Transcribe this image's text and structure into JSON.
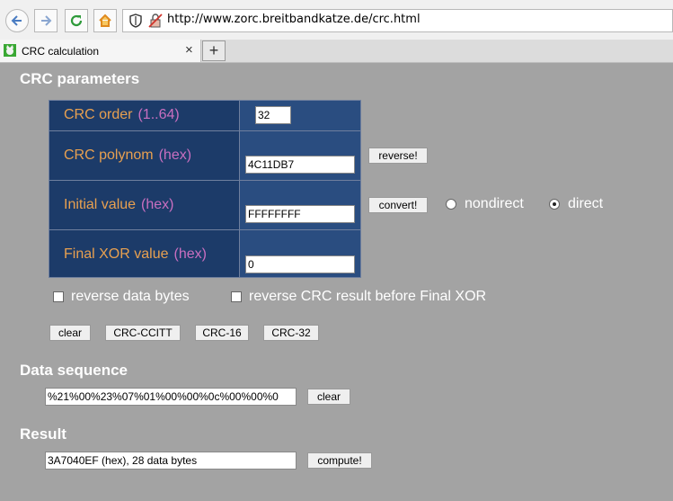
{
  "browser": {
    "url": "http://www.zorc.breitbandkatze.de/crc.html",
    "tab_title": "CRC calculation",
    "tab_close": "×",
    "new_tab": "+"
  },
  "params": {
    "heading": "CRC parameters",
    "order": {
      "label": "CRC order",
      "unit": "(1..64)",
      "value": "32"
    },
    "polynom": {
      "label": "CRC polynom",
      "unit": "(hex)",
      "value": "4C11DB7",
      "button": "reverse!"
    },
    "initial": {
      "label": "Initial value",
      "unit": "(hex)",
      "value": "FFFFFFFF",
      "button": "convert!"
    },
    "final_xor": {
      "label": "Final XOR value",
      "unit": "(hex)",
      "value": "0"
    },
    "radio_nondirect": "nondirect",
    "radio_direct": "direct",
    "selected_mode": "direct",
    "reverse_data_bytes": "reverse data bytes",
    "reverse_crc_result": "reverse CRC result before Final XOR",
    "presets": [
      "clear",
      "CRC-CCITT",
      "CRC-16",
      "CRC-32"
    ]
  },
  "data_sequence": {
    "heading": "Data sequence",
    "value": "%21%00%23%07%01%00%00%0c%00%00%0",
    "button": "clear"
  },
  "result": {
    "heading": "Result",
    "value": "3A7040EF (hex), 28 data bytes",
    "button": "compute!"
  }
}
